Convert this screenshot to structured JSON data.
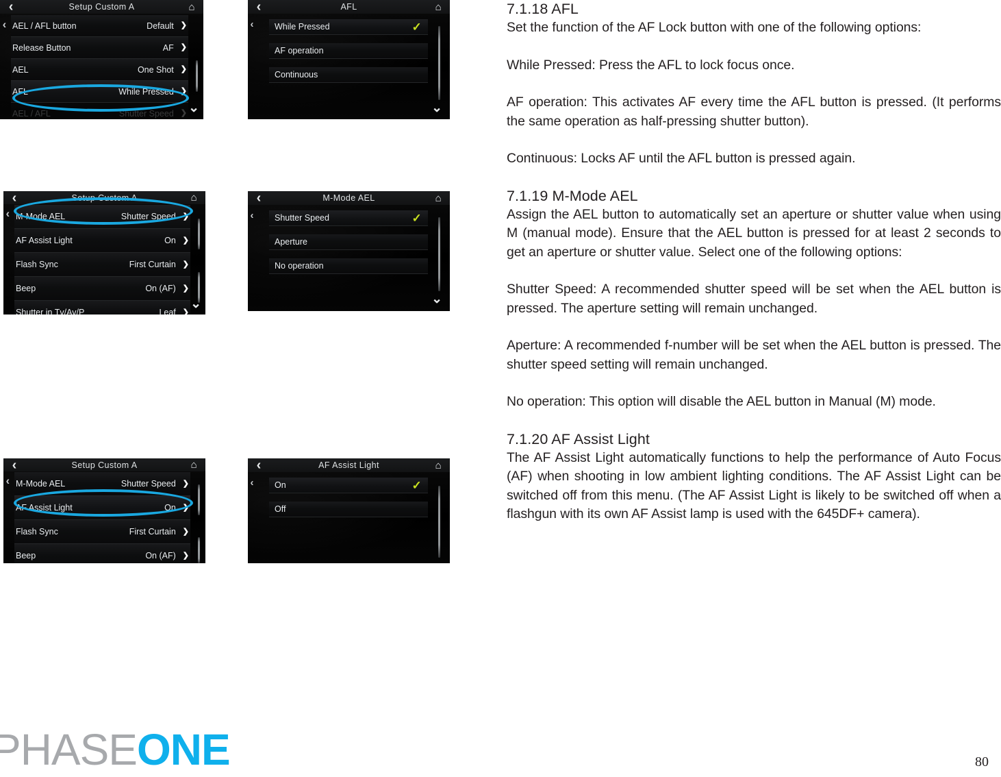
{
  "page": {
    "number": "80",
    "logo_part1": "PHASE",
    "logo_part2": "ONE"
  },
  "icons": {
    "back": "‹",
    "chevron_right": "❯",
    "chevron_down": "⌄",
    "home": "⌂",
    "check": "✓"
  },
  "screenshots": [
    {
      "id": "setup-custom-a-afl",
      "title": "Setup Custom A",
      "rows": [
        {
          "label": "AEL / AFL button",
          "value": "Default",
          "chevron": true
        },
        {
          "label": "Release Button",
          "value": "AF",
          "chevron": true
        },
        {
          "label": "AEL",
          "value": "One Shot",
          "chevron": true
        },
        {
          "label": "AFL",
          "value": "While Pressed",
          "chevron": true,
          "highlighted": true
        },
        {
          "label": "AEL / AFL",
          "value": "Shutter Speed",
          "chevron": true,
          "partial": true
        }
      ]
    },
    {
      "id": "afl-options",
      "title": "AFL",
      "rows": [
        {
          "label": "While Pressed",
          "checked": true
        },
        {
          "label": "AF operation",
          "checked": false
        },
        {
          "label": "Continuous",
          "checked": false
        }
      ]
    },
    {
      "id": "setup-custom-a-mmode",
      "title": "Setup Custom A",
      "rows": [
        {
          "label": "M-Mode AEL",
          "value": "Shutter Speed",
          "chevron": true,
          "highlighted": true
        },
        {
          "label": "AF Assist Light",
          "value": "On",
          "chevron": true
        },
        {
          "label": "Flash Sync",
          "value": "First Curtain",
          "chevron": true
        },
        {
          "label": "Beep",
          "value": "On (AF)",
          "chevron": true
        },
        {
          "label": "Shutter in Tv/Av/P",
          "value": "Leaf",
          "chevron": true
        }
      ]
    },
    {
      "id": "mmode-ael-options",
      "title": "M-Mode AEL",
      "rows": [
        {
          "label": "Shutter Speed",
          "checked": true
        },
        {
          "label": "Aperture",
          "checked": false
        },
        {
          "label": "No operation",
          "checked": false
        }
      ]
    },
    {
      "id": "setup-custom-a-afassist",
      "title": "Setup Custom A",
      "rows": [
        {
          "label": "M-Mode AEL",
          "value": "Shutter Speed",
          "chevron": true
        },
        {
          "label": "AF Assist Light",
          "value": "On",
          "chevron": true,
          "highlighted": true
        },
        {
          "label": "Flash Sync",
          "value": "First Curtain",
          "chevron": true
        },
        {
          "label": "Beep",
          "value": "On (AF)",
          "chevron": true
        }
      ]
    },
    {
      "id": "af-assist-light-options",
      "title": "AF Assist Light",
      "rows": [
        {
          "label": "On",
          "checked": true
        },
        {
          "label": "Off",
          "checked": false
        }
      ]
    }
  ],
  "sections": {
    "s7118": {
      "heading": "7.1.18  AFL",
      "intro": "Set the function of the AF Lock button with one of the following options:",
      "p1": "While Pressed: Press the AFL to lock focus once.",
      "p2": "AF operation: This activates AF every time the AFL button is pressed. (It performs the same operation as half-pressing shutter button).",
      "p3": "Continuous: Locks AF until the AFL button is pressed again."
    },
    "s7119": {
      "heading": "7.1.19  M-Mode AEL",
      "intro": "Assign the AEL button to automatically set an aperture or shutter value when using M (manual mode). Ensure that the AEL button is pressed for at least 2 seconds to get an aperture or shutter value. Select one of the following options:",
      "p1": "Shutter Speed: A recommended shutter speed will be set when the AEL button is pressed. The aperture setting will remain unchanged.",
      "p2": "Aperture: A recommended f-number will be set when the AEL button is pressed. The shutter speed setting will remain unchanged.",
      "p3": "No operation: This option will disable the AEL button in Manual (M) mode."
    },
    "s7120": {
      "heading": "7.1.20  AF Assist Light",
      "intro": "The AF Assist Light automatically functions to help the performance of  Auto Focus (AF) when shooting in low ambient lighting conditions.  The  AF Assist Light can be switched off from this menu. (The AF Assist Light is likely to be switched off when a flashgun with its own AF Assist lamp is used with the 645DF+ camera)."
    }
  },
  "colors": {
    "accent_cyan": "#1aa8e0",
    "logo_blue": "#0fb0ec",
    "logo_gray": "#a7a9ac",
    "check_green": "#c8e020",
    "text": "#231f20"
  }
}
